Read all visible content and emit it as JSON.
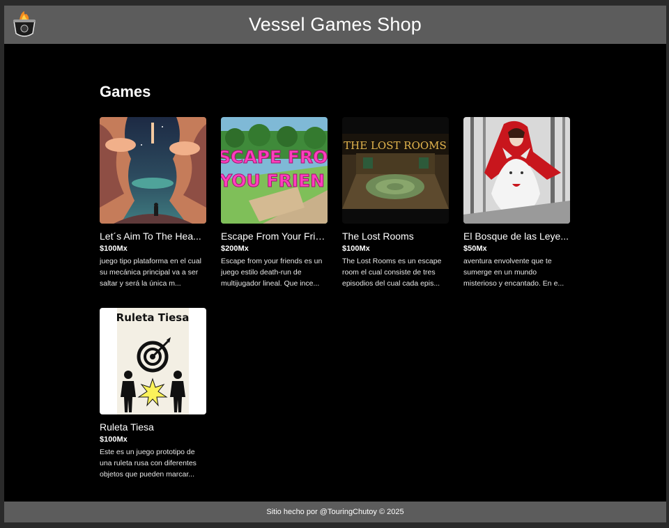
{
  "header": {
    "title": "Vessel Games Shop",
    "logo_icon": "flaming-cauldron-icon"
  },
  "main": {
    "section_title": "Games",
    "games": [
      {
        "title": "Let´s Aim To The Hea...",
        "price": "$100Mx",
        "description": "juego tipo plataforma en el cual su mecánica principal va a ser saltar y será la única m..."
      },
      {
        "title": "Escape From Your Frie...",
        "price": "$200Mx",
        "description": "Escape from your friends es un juego estilo death-run de multijugador lineal. Que ince...",
        "cover_text_1": "SCAPE FROM",
        "cover_text_2": "YOU FRIEN"
      },
      {
        "title": "The Lost Rooms",
        "price": "$100Mx",
        "description": "The Lost Rooms es un escape room el cual consiste de tres episodios del cual cada epis...",
        "cover_text": "THE LOST ROOMS"
      },
      {
        "title": "El Bosque de las Leye...",
        "price": "$50Mx",
        "description": "aventura envolvente que te sumerge en un mundo misterioso y encantado. En e..."
      },
      {
        "title": "Ruleta Tiesa",
        "price": "$100Mx",
        "description": "Este es un juego prototipo de una ruleta rusa con diferentes objetos que pueden marcar...",
        "cover_text": "Ruleta Tiesa"
      }
    ]
  },
  "footer": {
    "text": "Sitio hecho por @TouringChutoy © 2025"
  },
  "colors": {
    "header_bg": "#5c5c5c",
    "page_bg": "#000000",
    "text": "#ffffff"
  }
}
